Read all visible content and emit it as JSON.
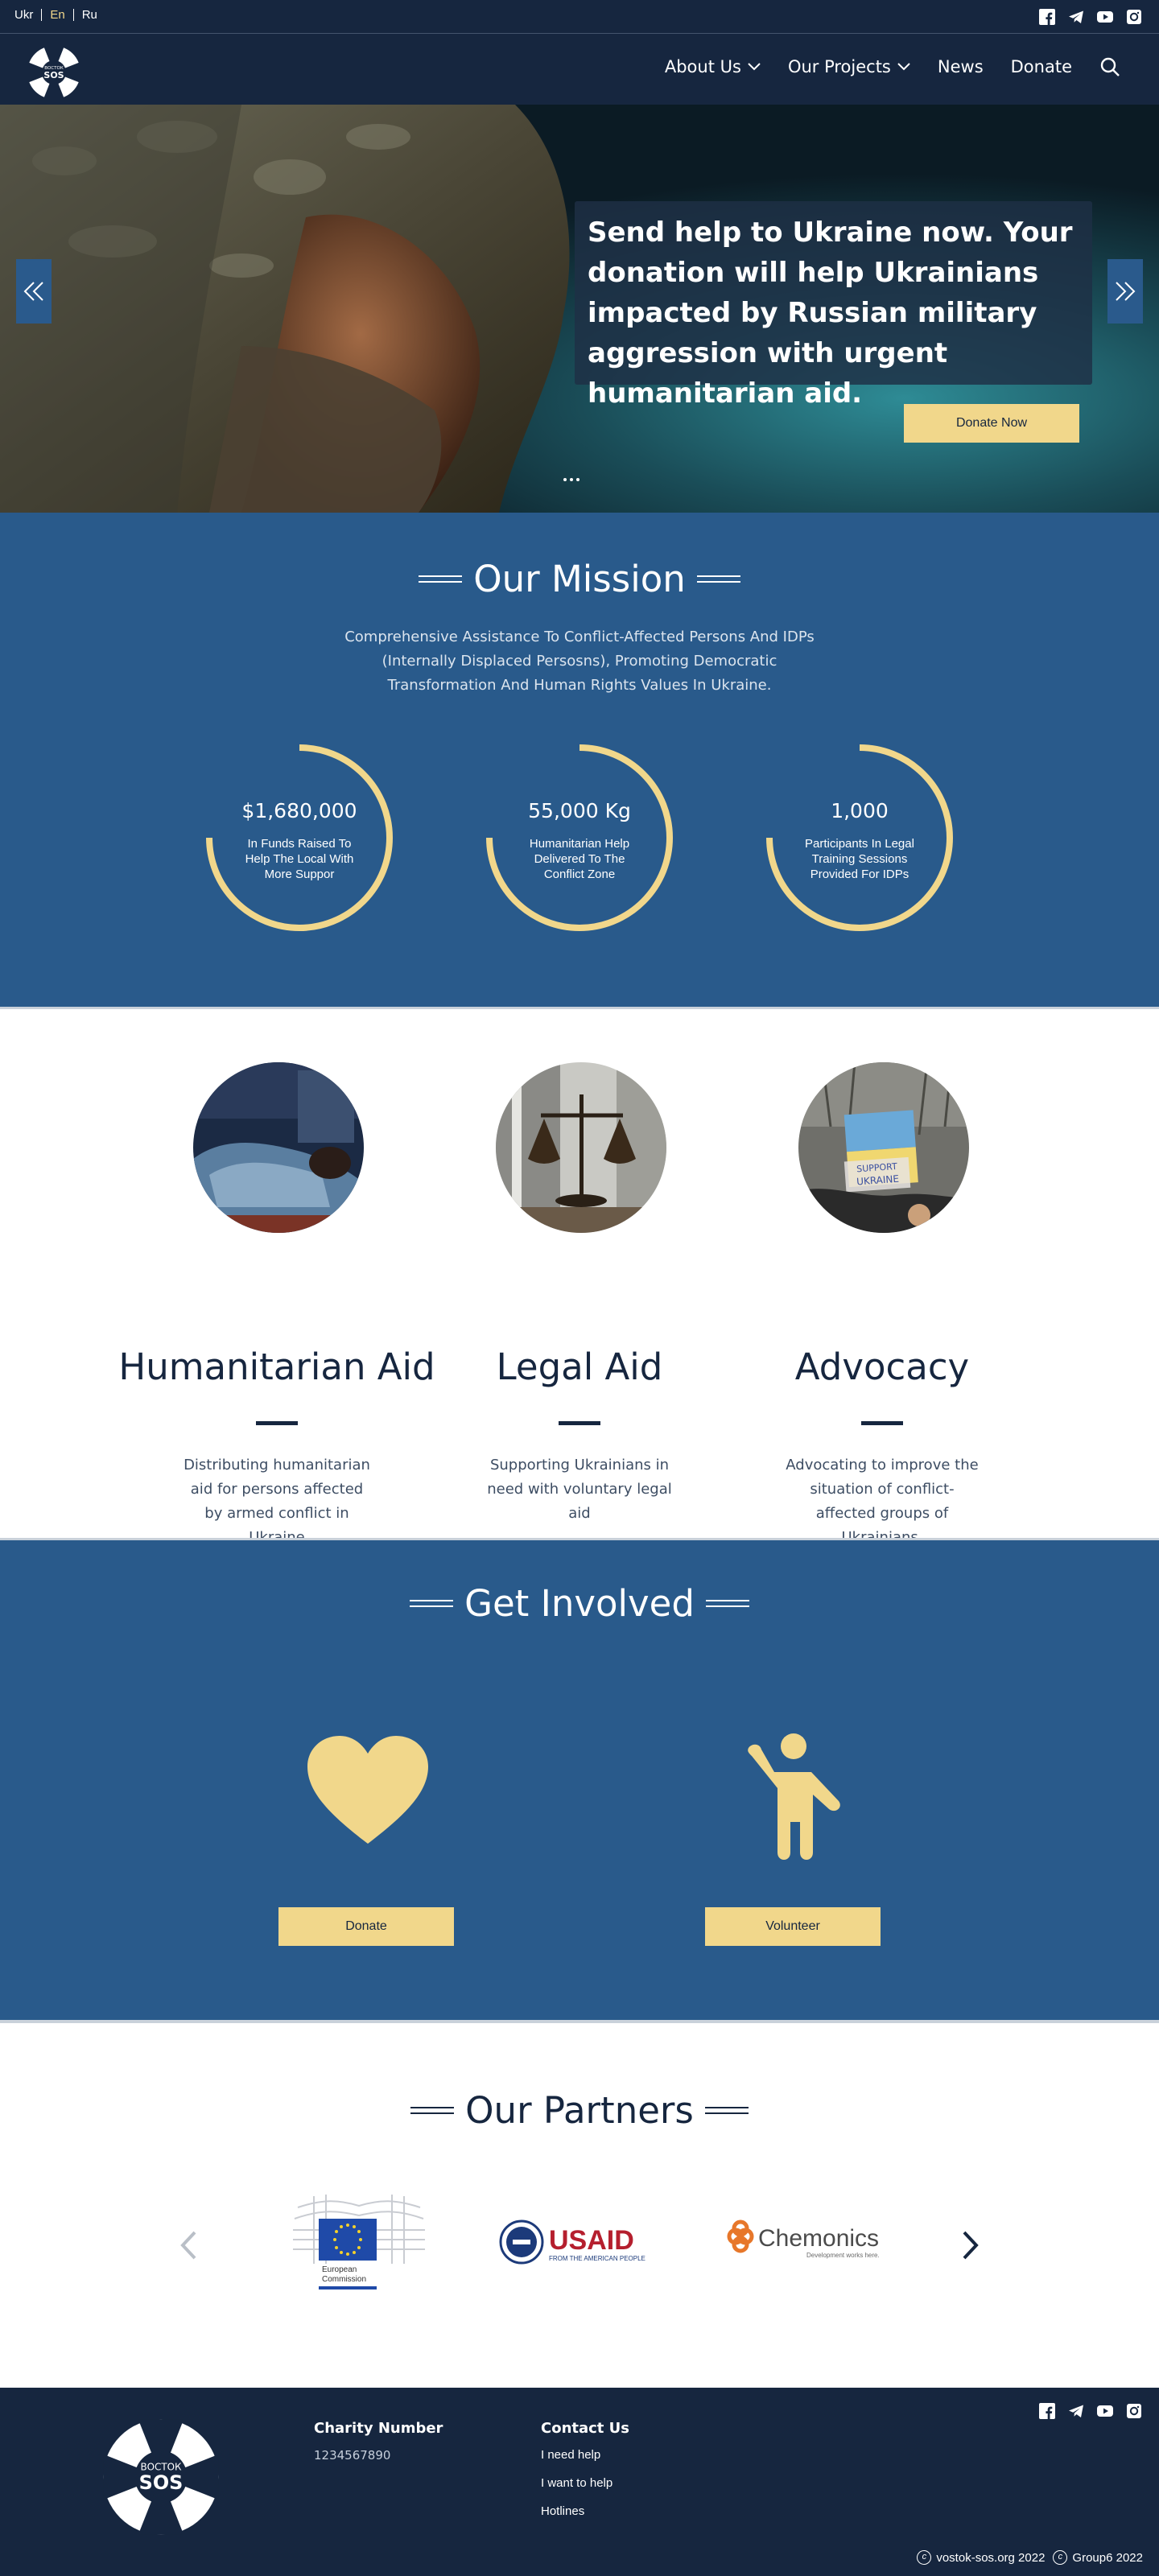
{
  "topbar": {
    "languages": [
      "Ukr",
      "En",
      "Ru"
    ],
    "active_language": "En"
  },
  "logo": {
    "top_text": "ВОСТОК",
    "main_text": "SOS"
  },
  "nav": {
    "items": [
      "About Us",
      "Our Projects",
      "News",
      "Donate"
    ]
  },
  "hero": {
    "message": "Send help to Ukraine now. Your donation will help Ukrainians impacted by Russian military aggression with urgent humanitarian aid.",
    "cta": "Donate Now"
  },
  "mission": {
    "title": "Our Mission",
    "text": "Comprehensive Assistance To Conflict-Affected Persons And IDPs (Internally Displaced Persosns), Promoting Democratic Transformation And Human Rights Values In Ukraine.",
    "stats": [
      {
        "value": "$1,680,000",
        "caption": "In Funds Raised To Help The Local With More Suppor"
      },
      {
        "value": "55,000 Kg",
        "caption": "Humanitarian Help Delivered To The Conflict Zone"
      },
      {
        "value": "1,000",
        "caption": "Participants In Legal Training Sessions Provided For IDPs"
      }
    ]
  },
  "services": [
    {
      "name": "Humanitarian Aid",
      "desc": "Distributing humanitarian aid for persons affected by armed conflict in Ukraine"
    },
    {
      "name": "Legal Aid",
      "desc": "Supporting Ukrainians in need with voluntary legal aid"
    },
    {
      "name": "Advocacy",
      "desc": "Advocating to improve  the situation of conflict-affected groups of Ukrainians."
    }
  ],
  "advocacy_sign": [
    "SUPPORT",
    "UKRAINE"
  ],
  "involved": {
    "title": "Get Involved",
    "donate_label": "Donate",
    "volunteer_label": "Volunteer"
  },
  "partners": {
    "title": "Our Partners",
    "eu": {
      "line1": "European",
      "line2": "Commission"
    },
    "usaid": {
      "name": "USAID",
      "tagline": "FROM THE AMERICAN PEOPLE"
    },
    "chemonics": {
      "name": "Chemonics",
      "tagline": "Development works here."
    }
  },
  "footer": {
    "charity_title": "Charity Number",
    "charity_number": "1234567890",
    "contact_title": "Contact Us",
    "links": [
      "I need help",
      "I want to help",
      "Hotlines"
    ],
    "copyright_site": "vostok-sos.org 2022",
    "copyright_group": "Group6 2022"
  },
  "colors": {
    "navy": "#16263f",
    "blue": "#295a8b",
    "gold": "#f1d78b"
  }
}
